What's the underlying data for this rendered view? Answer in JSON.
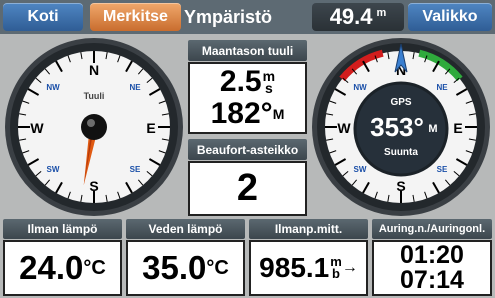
{
  "topbar": {
    "home_label": "Koti",
    "mark_label": "Merkitse",
    "title": "Ympäristö",
    "depth_value": "49.4",
    "depth_unit": "m",
    "menu_label": "Valikko"
  },
  "wind_compass": {
    "label": "Tuuli",
    "cardinals": {
      "n": "N",
      "s": "S",
      "e": "E",
      "w": "W",
      "nw": "NW",
      "ne": "NE",
      "sw": "SW",
      "se": "SE"
    },
    "needle_deg": 190
  },
  "ground_wind": {
    "title": "Maantason tuuli",
    "speed": "2.5",
    "speed_unit_top": "m",
    "speed_unit_bottom": "s",
    "direction": "182°",
    "direction_suffix": "M"
  },
  "beaufort": {
    "title": "Beaufort-asteikko",
    "value": "2"
  },
  "gps_compass": {
    "label_top": "GPS",
    "heading": "353°",
    "heading_suffix": "M",
    "label_bottom": "Suunta",
    "cardinals": {
      "n": "N",
      "s": "S",
      "e": "E",
      "w": "W",
      "nw": "NW",
      "ne": "NE",
      "sw": "SW",
      "se": "SE"
    },
    "colors": {
      "port": "#d21d1d",
      "starboard": "#2faa3c"
    }
  },
  "bottom": {
    "air_temp": {
      "title": "Ilman lämpö",
      "value": "24.0",
      "unit": "°C"
    },
    "water_temp": {
      "title": "Veden lämpö",
      "value": "35.0",
      "unit": "°C"
    },
    "pressure": {
      "title": "Ilmanp.mitt.",
      "value": "985.1",
      "unit_top": "m",
      "unit_bottom": "b",
      "trend": "→"
    },
    "sun": {
      "title": "Auring.n./Auringonl.",
      "rise": "01:20",
      "set": "07:14"
    }
  }
}
